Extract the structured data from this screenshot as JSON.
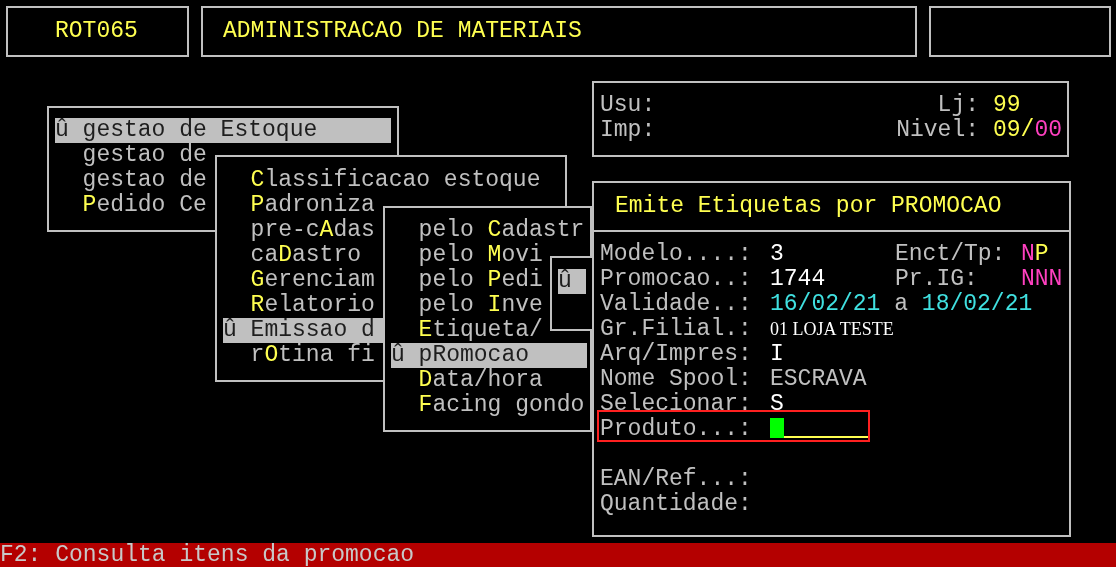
{
  "header": {
    "program_code": "ROT065",
    "title": "ADMINISTRACAO DE MATERIAIS"
  },
  "info_panel": {
    "rows": [
      {
        "label": "Usu:",
        "right_label": "Lj:",
        "right_parts": [
          {
            "text": "99",
            "color": "#ffff50"
          }
        ]
      },
      {
        "label": "Imp:",
        "right_label": "Nivel:",
        "right_parts": [
          {
            "text": "09/",
            "color": "#ffff50"
          },
          {
            "text": "00",
            "color": "#ff40c0"
          }
        ]
      }
    ]
  },
  "menus": [
    {
      "items": [
        {
          "marker": "û",
          "pre": "gestao de Estoque",
          "selected": true
        },
        {
          "pre": "gestao de",
          "selected": false
        },
        {
          "pre": "gestao de",
          "selected": false
        },
        {
          "key": "P",
          "post": "edido Ce",
          "selected": false
        }
      ]
    },
    {
      "items": [
        {
          "key": "C",
          "post": "lassificacao estoque",
          "selected": false
        },
        {
          "key": "P",
          "post": "adroniza",
          "selected": false
        },
        {
          "pre": "pre-c",
          "key": "A",
          "post": "das",
          "selected": false
        },
        {
          "pre": "ca",
          "key": "D",
          "post": "astro",
          "selected": false
        },
        {
          "key": "G",
          "post": "erenciam",
          "selected": false
        },
        {
          "key": "R",
          "post": "elatorio",
          "selected": false
        },
        {
          "marker": "û",
          "pre": "Emissao d",
          "selected": true
        },
        {
          "pre": "r",
          "key": "O",
          "post": "tina fi",
          "selected": false
        }
      ]
    },
    {
      "items": [
        {
          "pre": "pelo ",
          "key": "C",
          "post": "adastr",
          "selected": false
        },
        {
          "pre": "pelo ",
          "key": "M",
          "post": "ovi",
          "selected": false
        },
        {
          "pre": "pelo ",
          "key": "P",
          "post": "edi",
          "selected": false
        },
        {
          "pre": "pelo ",
          "key": "I",
          "post": "nve",
          "selected": false
        },
        {
          "key": "E",
          "post": "tiqueta/",
          "selected": false
        },
        {
          "marker": "û",
          "pre": "pRomocao",
          "selected": true
        },
        {
          "key": "D",
          "post": "ata/hora",
          "selected": false
        },
        {
          "key": "F",
          "post": "acing gondo",
          "selected": false
        }
      ]
    },
    {
      "items": [
        {
          "marker": "û",
          "selected": true
        }
      ]
    }
  ],
  "form": {
    "title": "Emite Etiquetas por PROMOCAO",
    "fields": [
      {
        "kind": "text",
        "label": "Modelo....:",
        "value_parts": [
          {
            "text": "3",
            "color": "#ffffff"
          }
        ],
        "right_label": "Enct/Tp:",
        "right_parts": [
          {
            "text": "N",
            "color": "#ff40c0"
          },
          {
            "text": "P",
            "color": "#ffff50"
          }
        ]
      },
      {
        "kind": "text",
        "label": "Promocao..:",
        "value_parts": [
          {
            "text": "1744",
            "color": "#ffffff"
          }
        ],
        "right_label": "Pr.IG:",
        "right_parts": [
          {
            "text": "NNN",
            "color": "#ff40c0"
          }
        ]
      },
      {
        "kind": "text",
        "label": "Validade..:",
        "parts_spaced": true,
        "value_parts": [
          {
            "text": "16/02/21",
            "color": "#40e0e0"
          },
          {
            "text": "a",
            "color": "#c0c0c0"
          },
          {
            "text": "18/02/21",
            "color": "#40e0e0"
          }
        ]
      },
      {
        "kind": "proportional",
        "label": "Gr.Filial.:",
        "value_parts": [
          {
            "text": "01 LOJA TESTE",
            "color": "#ffffff"
          }
        ]
      },
      {
        "kind": "text",
        "label": "Arq/Impres:",
        "value_parts": [
          {
            "text": "I",
            "color": "#ffffff"
          }
        ]
      },
      {
        "kind": "text",
        "label": "Nome Spool:",
        "value_parts": [
          {
            "text": "ESCRAVA",
            "color": "#c0c0c0"
          }
        ]
      },
      {
        "kind": "text",
        "label": "Selecionar:",
        "value_parts": [
          {
            "text": "S",
            "color": "#ffffff"
          }
        ]
      },
      {
        "kind": "input",
        "label": "Produto...:",
        "focused": true
      }
    ],
    "lower_fields": [
      {
        "label": "EAN/Ref...:"
      },
      {
        "label": "Quantidade:"
      }
    ]
  },
  "status_bar": "F2: Consulta itens da promocao"
}
